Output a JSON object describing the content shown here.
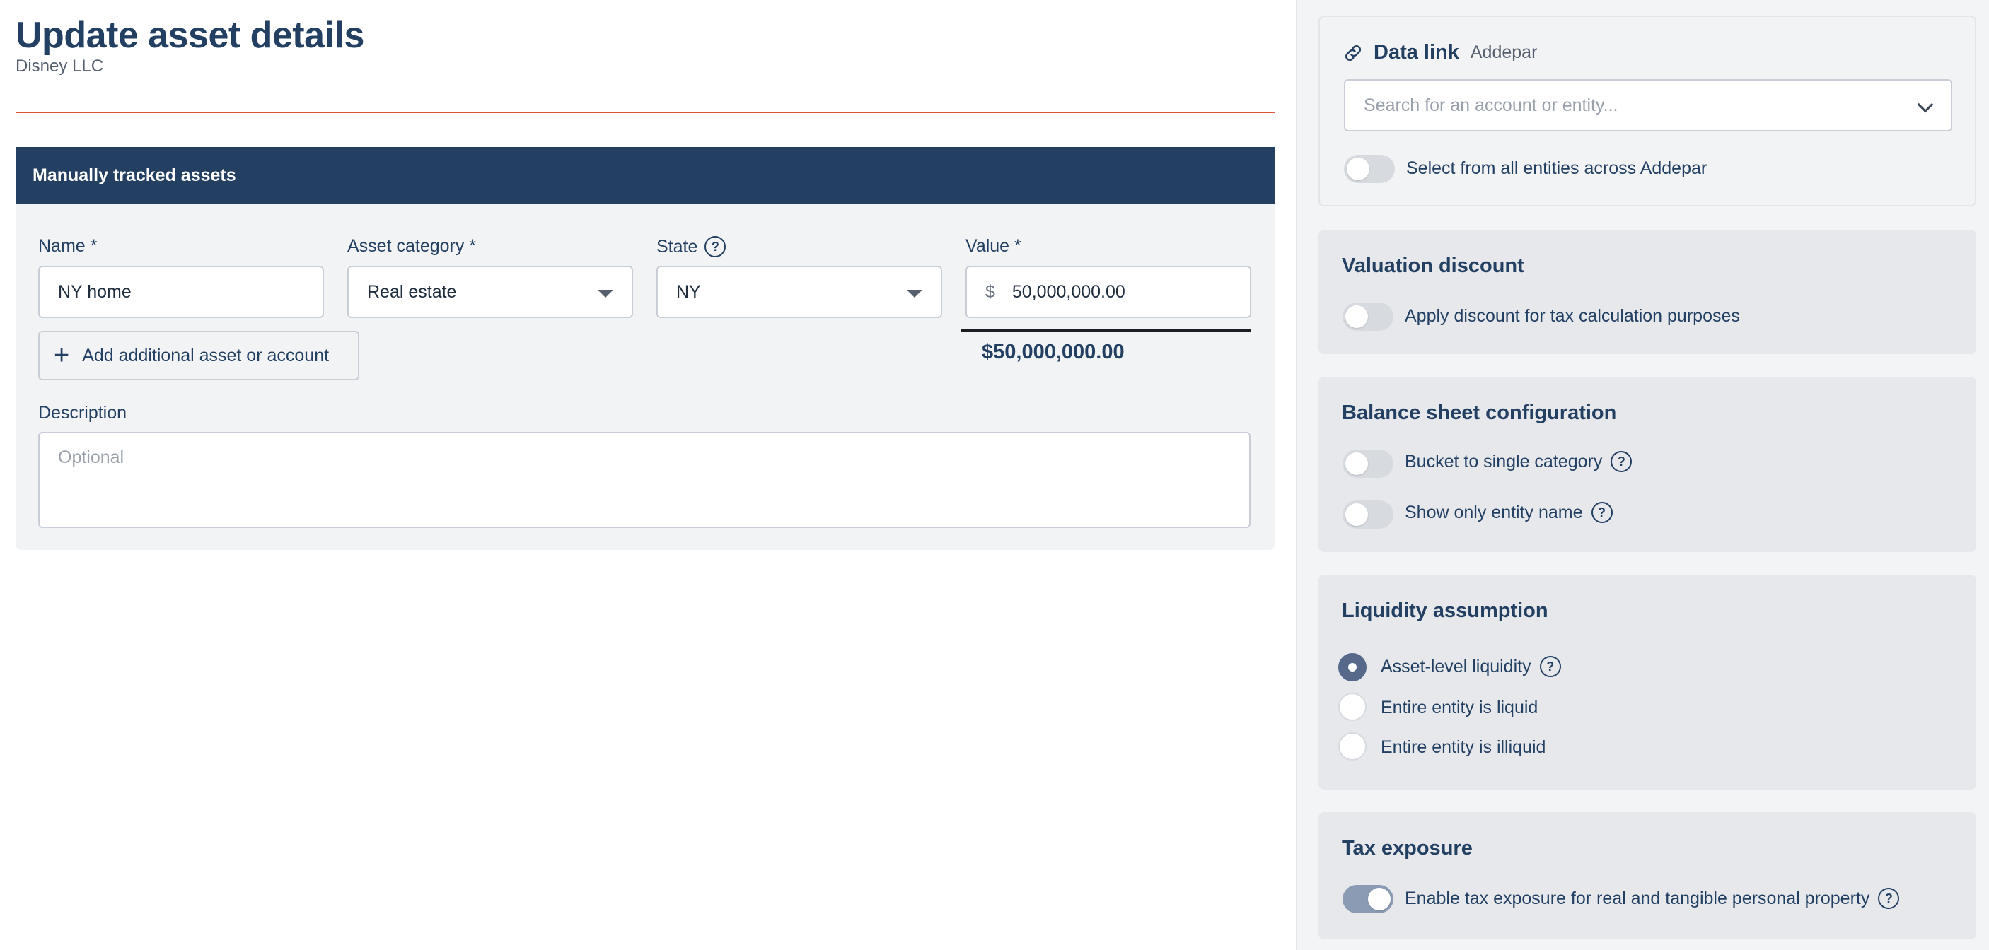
{
  "page": {
    "title": "Update asset details",
    "subtitle": "Disney LLC"
  },
  "section": {
    "header": "Manually tracked assets",
    "fields": {
      "name_label": "Name *",
      "name_value": "NY home",
      "category_label": "Asset category *",
      "category_value": "Real estate",
      "state_label": "State",
      "state_value": "NY",
      "value_label": "Value *",
      "currency_symbol": "$",
      "value_amount": "50,000,000.00",
      "value_total": "$50,000,000.00"
    },
    "add_button_label": "Add additional asset or account",
    "description_label": "Description",
    "description_placeholder": "Optional"
  },
  "data_link": {
    "title": "Data link",
    "source": "Addepar",
    "search_placeholder": "Search for an account or entity...",
    "toggle_label": "Select from all entities across Addepar",
    "toggle_on": false
  },
  "valuation_discount": {
    "title": "Valuation discount",
    "toggle_label": "Apply discount for tax calculation purposes",
    "toggle_on": false
  },
  "balance_sheet": {
    "title": "Balance sheet configuration",
    "options": [
      {
        "label": "Bucket to single category",
        "on": false
      },
      {
        "label": "Show only entity name",
        "on": false
      }
    ]
  },
  "liquidity": {
    "title": "Liquidity assumption",
    "options": [
      {
        "label": "Asset-level liquidity",
        "checked": true
      },
      {
        "label": "Entire entity is liquid",
        "checked": false
      },
      {
        "label": "Entire entity is illiquid",
        "checked": false
      }
    ]
  },
  "tax_exposure": {
    "title": "Tax exposure",
    "toggle_label": "Enable tax exposure for real and tangible personal property",
    "toggle_on": true
  },
  "icons": {
    "help": "question-circle-icon",
    "link": "link-icon",
    "plus": "plus-icon",
    "caret": "caret-down-icon",
    "chevron": "chevron-down-icon"
  },
  "colors": {
    "navy": "#233f62",
    "accent_rule": "#d9533f",
    "toggle_on": "#8a9bb3",
    "radio_checked": "#56698a"
  }
}
